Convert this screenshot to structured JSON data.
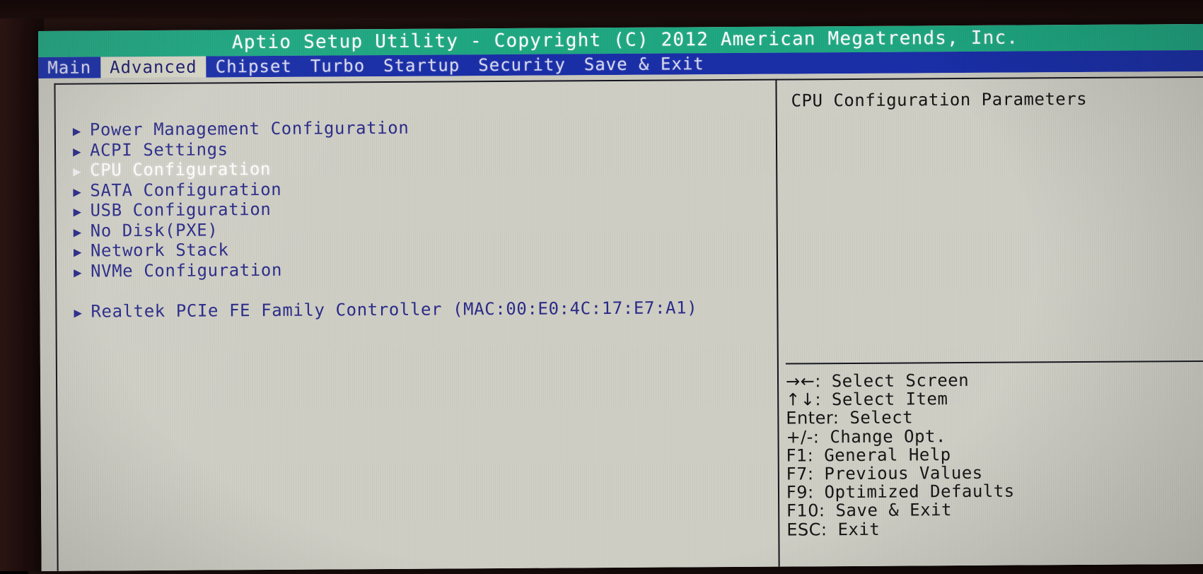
{
  "title_bar": {
    "text": "Aptio Setup Utility - Copyright (C) 2012 American Megatrends, Inc."
  },
  "colors": {
    "title_bar_bg": "#1fa882",
    "menu_bar_bg": "#1a2fa8",
    "active_tab_bg": "#d8d8c8",
    "active_tab_fg": "#1a1a6e",
    "screen_bg": "#c9c9c0",
    "item_fg": "#2b2b8a",
    "selected_item_fg": "#ffffff",
    "help_fg": "#151515"
  },
  "menu_bar": {
    "tabs": [
      {
        "label": "Main",
        "active": false
      },
      {
        "label": "Advanced",
        "active": true
      },
      {
        "label": "Chipset",
        "active": false
      },
      {
        "label": "Turbo",
        "active": false
      },
      {
        "label": "Startup",
        "active": false
      },
      {
        "label": "Security",
        "active": false
      },
      {
        "label": "Save & Exit",
        "active": false
      }
    ]
  },
  "main_panel": {
    "items": [
      {
        "label": "Power Management Configuration",
        "arrow": "submenu-arrow-icon",
        "selected": false
      },
      {
        "label": "ACPI Settings",
        "arrow": "submenu-arrow-icon",
        "selected": false
      },
      {
        "label": "CPU Configuration",
        "arrow": "submenu-arrow-icon",
        "selected": true
      },
      {
        "label": "SATA Configuration",
        "arrow": "submenu-arrow-icon",
        "selected": false
      },
      {
        "label": "USB Configuration",
        "arrow": "submenu-arrow-icon",
        "selected": false
      },
      {
        "label": "No Disk(PXE)",
        "arrow": "submenu-arrow-icon",
        "selected": false
      },
      {
        "label": "Network Stack",
        "arrow": "submenu-arrow-icon",
        "selected": false
      },
      {
        "label": "NVMe Configuration",
        "arrow": "submenu-arrow-icon",
        "selected": false
      }
    ],
    "device_items": [
      {
        "label": "Realtek PCIe FE Family Controller (MAC:00:E0:4C:17:E7:A1)",
        "arrow": "submenu-arrow-icon",
        "selected": false
      }
    ]
  },
  "help_panel": {
    "description": "CPU Configuration Parameters",
    "legend": [
      {
        "keys": "→←:",
        "action": "Select Screen"
      },
      {
        "keys": "↑↓:",
        "action": "Select Item"
      },
      {
        "keys": "Enter:",
        "action": "Select"
      },
      {
        "keys": "+/-:",
        "action": "Change Opt."
      },
      {
        "keys": "F1:",
        "action": "General Help"
      },
      {
        "keys": "F7:",
        "action": "Previous Values"
      },
      {
        "keys": "F9:",
        "action": "Optimized Defaults"
      },
      {
        "keys": "F10:",
        "action": "Save & Exit"
      },
      {
        "keys": "ESC:",
        "action": "Exit"
      }
    ]
  }
}
